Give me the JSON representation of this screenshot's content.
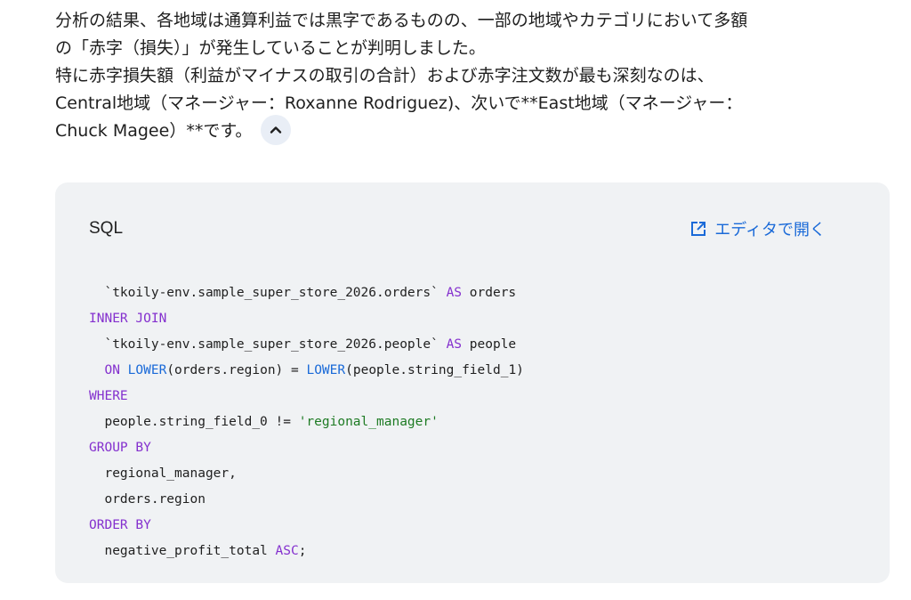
{
  "answer": {
    "lines": [
      "分析の結果、各地域は通算利益では黒字であるものの、一部の地域やカテゴリにおいて多額",
      "の「赤字（損失）」が発生していることが判明しました。",
      "特に赤字損失額（利益がマイナスの取引の合計）および赤字注文数が最も深刻なのは、",
      "Central地域（マネージャー：Roxanne Rodriguez)、次いで**East地域（マネージャー：",
      "Chuck Magee）**です。"
    ],
    "collapse_icon": "chevron-up-icon"
  },
  "code_card": {
    "language": "SQL",
    "open_editor_label": "エディタで開く",
    "open_editor_icon": "open-in-new-icon",
    "colors": {
      "keyword": "#8430ce",
      "function": "#1a6ad8",
      "string": "#1e7b24",
      "plain": "#1f1f1f",
      "background": "#f0f2f4"
    },
    "lines": [
      [
        {
          "t": "plain",
          "v": "  `tkoily-env.sample_super_store_2026.orders` "
        },
        {
          "t": "kw",
          "v": "AS"
        },
        {
          "t": "plain",
          "v": " orders"
        }
      ],
      [
        {
          "t": "kw",
          "v": "INNER JOIN"
        }
      ],
      [
        {
          "t": "plain",
          "v": "  `tkoily-env.sample_super_store_2026.people` "
        },
        {
          "t": "kw",
          "v": "AS"
        },
        {
          "t": "plain",
          "v": " people"
        }
      ],
      [
        {
          "t": "plain",
          "v": "  "
        },
        {
          "t": "kw",
          "v": "ON"
        },
        {
          "t": "plain",
          "v": " "
        },
        {
          "t": "fn",
          "v": "LOWER"
        },
        {
          "t": "plain",
          "v": "(orders.region) = "
        },
        {
          "t": "fn",
          "v": "LOWER"
        },
        {
          "t": "plain",
          "v": "(people.string_field_1)"
        }
      ],
      [
        {
          "t": "kw",
          "v": "WHERE"
        }
      ],
      [
        {
          "t": "plain",
          "v": "  people.string_field_0 != "
        },
        {
          "t": "str",
          "v": "'regional_manager'"
        }
      ],
      [
        {
          "t": "kw",
          "v": "GROUP BY"
        }
      ],
      [
        {
          "t": "plain",
          "v": "  regional_manager,"
        }
      ],
      [
        {
          "t": "plain",
          "v": "  orders.region"
        }
      ],
      [
        {
          "t": "kw",
          "v": "ORDER BY"
        }
      ],
      [
        {
          "t": "plain",
          "v": "  negative_profit_total "
        },
        {
          "t": "kw",
          "v": "ASC"
        },
        {
          "t": "plain",
          "v": ";"
        }
      ]
    ]
  }
}
